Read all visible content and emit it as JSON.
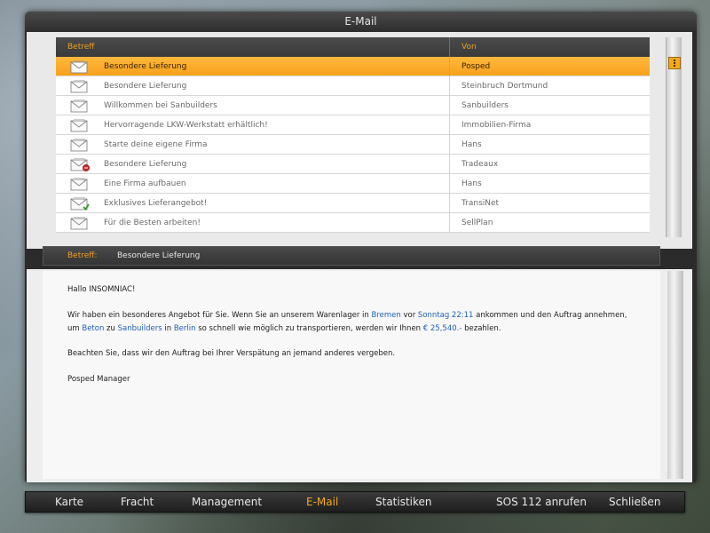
{
  "window": {
    "title": "E-Mail"
  },
  "list": {
    "col_subject": "Betreff",
    "col_from": "Von",
    "rows": [
      {
        "subject": "Besondere Lieferung",
        "from": "Posped",
        "icon": "envelope-icon",
        "selected": true
      },
      {
        "subject": "Besondere Lieferung",
        "from": "Steinbruch Dortmund",
        "icon": "envelope-icon"
      },
      {
        "subject": "Willkommen bei Sanbuilders",
        "from": "Sanbuilders",
        "icon": "envelope-icon"
      },
      {
        "subject": "Hervorragende LKW-Werkstatt erhältlich!",
        "from": "Immobilien-Firma",
        "icon": "envelope-icon"
      },
      {
        "subject": "Starte deine eigene Firma",
        "from": "Hans",
        "icon": "envelope-icon"
      },
      {
        "subject": "Besondere Lieferung",
        "from": "Tradeaux",
        "icon": "envelope-declined-icon"
      },
      {
        "subject": "Eine Firma aufbauen",
        "from": "Hans",
        "icon": "envelope-icon"
      },
      {
        "subject": "Exklusives Lieferangebot!",
        "from": "TransiNet",
        "icon": "envelope-accepted-icon"
      },
      {
        "subject": "Für die Besten arbeiten!",
        "from": "SellPlan",
        "icon": "envelope-icon"
      }
    ]
  },
  "message": {
    "subject_label": "Betreff:",
    "subject_value": "Besondere Lieferung",
    "greeting": "Hallo INSOMNIAC!",
    "p1_a": "Wir haben ein besonderes Angebot für Sie. Wenn Sie an unserem Warenlager in ",
    "p1_city": "Bremen",
    "p1_b": " vor ",
    "p1_time": "Sonntag 22:11",
    "p1_c": " ankommen und den Auftrag annehmen, um ",
    "p1_cargo": "Beton",
    "p1_d": " zu ",
    "p1_company": "Sanbuilders",
    "p1_e": " in ",
    "p1_dest": "Berlin",
    "p1_f": " so schnell wie möglich zu transportieren, werden wir Ihnen ",
    "p1_amount": "€ 25,540.-",
    "p1_g": " bezahlen.",
    "p2": "Beachten Sie, dass wir den Auftrag bei Ihrer Verspätung an jemand anderes vergeben.",
    "signature": "Posped Manager"
  },
  "nav": {
    "items": [
      "Karte",
      "Fracht",
      "Management",
      "E-Mail",
      "Statistiken",
      "SOS 112 anrufen",
      "Schließen"
    ],
    "active": "E-Mail"
  },
  "colors": {
    "accent": "#f4a81c",
    "link": "#1f5fb8"
  }
}
